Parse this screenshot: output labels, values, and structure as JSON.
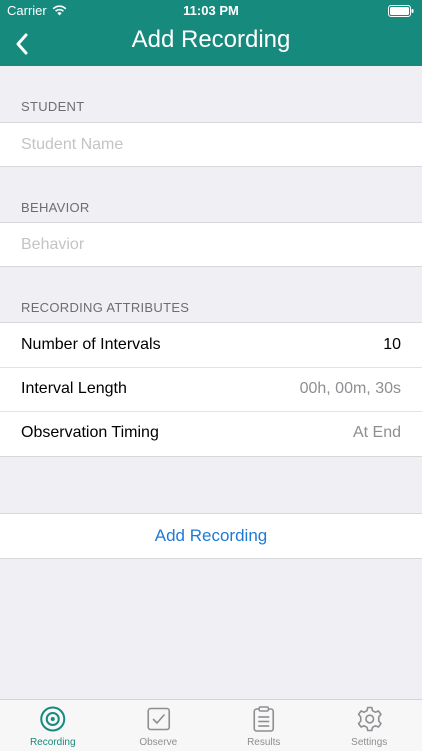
{
  "status_bar": {
    "carrier": "Carrier",
    "time": "11:03 PM"
  },
  "nav": {
    "title": "Add Recording"
  },
  "student": {
    "header": "STUDENT",
    "placeholder": "Student Name",
    "value": ""
  },
  "behavior": {
    "header": "BEHAVIOR",
    "placeholder": "Behavior",
    "value": ""
  },
  "attributes": {
    "header": "RECORDING ATTRIBUTES",
    "rows": [
      {
        "label": "Number of Intervals",
        "value": "10"
      },
      {
        "label": "Interval Length",
        "value": "00h, 00m, 30s"
      },
      {
        "label": "Observation Timing",
        "value": "At End"
      }
    ]
  },
  "action": {
    "label": "Add Recording"
  },
  "tabs": [
    {
      "label": "Recording",
      "icon": "target-icon",
      "active": true
    },
    {
      "label": "Observe",
      "icon": "checkbox-icon",
      "active": false
    },
    {
      "label": "Results",
      "icon": "list-icon",
      "active": false
    },
    {
      "label": "Settings",
      "icon": "gear-icon",
      "active": false
    }
  ],
  "colors": {
    "accent": "#178a7e",
    "link": "#1f7ad6",
    "background": "#efeff4"
  }
}
